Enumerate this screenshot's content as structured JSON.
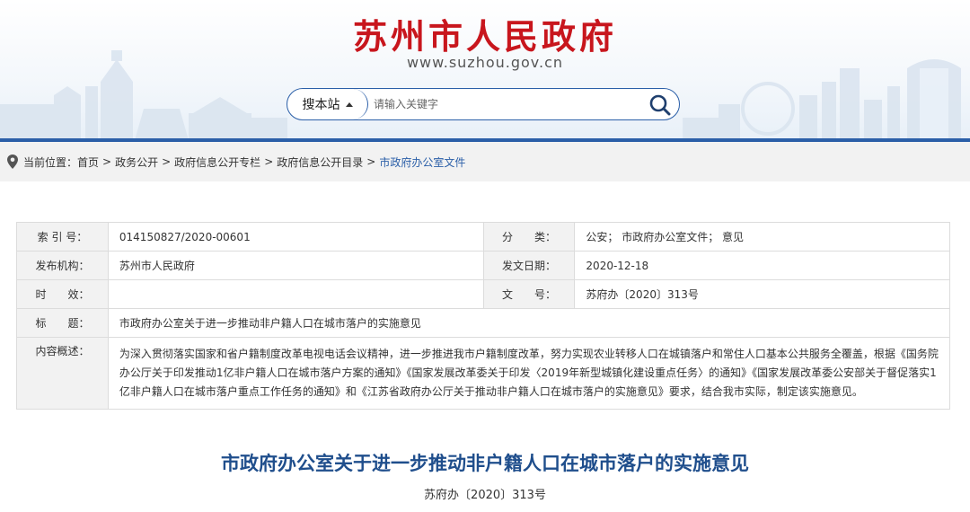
{
  "header": {
    "site_title": "苏州市人民政府",
    "site_url": "www.suzhou.gov.cn"
  },
  "search": {
    "scope_label": "搜本站",
    "placeholder": "请输入关键字",
    "search_icon": "search-icon",
    "dropdown_icon": "caret-up-icon"
  },
  "breadcrumb": {
    "prefix": "当前位置：",
    "location_icon": "location-pin-icon",
    "items": [
      "首页",
      "政务公开",
      "政府信息公开专栏",
      "政府信息公开目录",
      "市政府办公室文件"
    ],
    "separator": ">"
  },
  "info": {
    "index_label": "索 引 号：",
    "index_value": "014150827/2020-00601",
    "category_label": "分　　类：",
    "category_value": "公安； 市政府办公室文件； 意见",
    "publisher_label": "发布机构：",
    "publisher_value": "苏州市人民政府",
    "date_label": "发文日期：",
    "date_value": "2020-12-18",
    "validity_label": "时　　效：",
    "validity_value": "",
    "docno_label": "文　　号：",
    "docno_value": "苏府办〔2020〕313号",
    "subject_label": "标　　题：",
    "subject_value": "市政府办公室关于进一步推动非户籍人口在城市落户的实施意见",
    "summary_label": "内容概述：",
    "summary_value": "为深入贯彻落实国家和省户籍制度改革电视电话会议精神，进一步推进我市户籍制度改革，努力实现农业转移人口在城镇落户和常住人口基本公共服务全覆盖，根据《国务院办公厅关于印发推动1亿非户籍人口在城市落户方案的通知》《国家发展改革委关于印发〈2019年新型城镇化建设重点任务〉的通知》《国家发展改革委公安部关于督促落实1亿非户籍人口在城市落户重点工作任务的通知》和《江苏省政府办公厅关于推动非户籍人口在城市落户的实施意见》要求，结合我市实际，制定该实施意见。"
  },
  "document": {
    "title": "市政府办公室关于进一步推动非户籍人口在城市落户的实施意见",
    "number": "苏府办〔2020〕313号"
  },
  "colors": {
    "brand_red": "#c8161d",
    "brand_blue": "#2b5fa8",
    "title_blue": "#1f4e8c"
  }
}
